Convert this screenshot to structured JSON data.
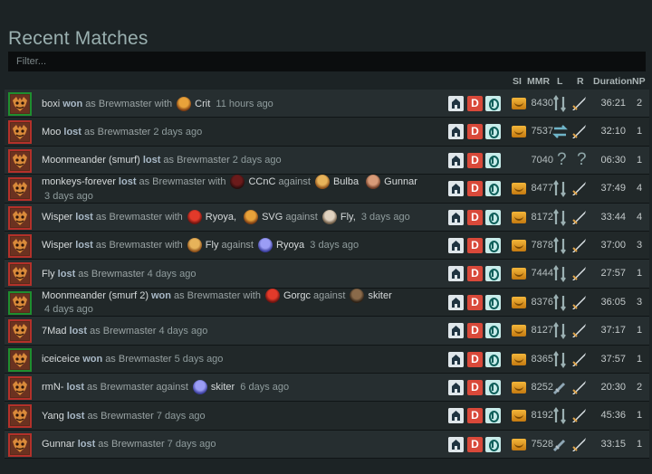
{
  "title": "Recent Matches",
  "filter": {
    "placeholder": "Filter..."
  },
  "headers": {
    "si": "SI",
    "mmr": "MMR",
    "l": "L",
    "r": "R",
    "duration": "Duration",
    "np": "NP"
  },
  "colors": {
    "win_border": "#1f8e2f",
    "loss_border": "#b3312a",
    "dire_red": "#d9493a"
  },
  "matches": [
    {
      "result": "win",
      "player": "boxi",
      "result_text": "won",
      "hero_text": "as Brewmaster",
      "with_text": "with",
      "with": [
        {
          "name": "Crit",
          "pic": "p1"
        }
      ],
      "against_text": "",
      "against": [],
      "ago": "11 hours ago",
      "mode": "D",
      "mmr": "8430",
      "lane_l": "mid-arrows",
      "lane_r": "sword",
      "duration": "36:21",
      "np": "2"
    },
    {
      "result": "loss",
      "player": "Moo",
      "result_text": "lost",
      "hero_text": "as Brewmaster",
      "with_text": "",
      "with": [],
      "against_text": "",
      "against": [],
      "ago": "2 days ago",
      "mode": "D",
      "mmr": "7537",
      "lane_l": "swap",
      "lane_r": "sword",
      "duration": "32:10",
      "np": "1"
    },
    {
      "result": "loss",
      "player": "Moonmeander (smurf)",
      "result_text": "lost",
      "hero_text": "as Brewmaster",
      "with_text": "",
      "with": [],
      "against_text": "",
      "against": [],
      "ago": "2 days ago",
      "mode": "D",
      "mmr": "7040",
      "lane_l": "unknown",
      "lane_r": "unknown",
      "duration": "06:30",
      "np": "1",
      "no_medal": true
    },
    {
      "result": "loss",
      "player": "monkeys-forever",
      "result_text": "lost",
      "hero_text": "as Brewmaster",
      "with_text": "with",
      "with": [
        {
          "name": "CCnC",
          "pic": "p2"
        }
      ],
      "against_text": "against",
      "against": [
        {
          "name": "Bulba",
          "pic": "p3"
        },
        {
          "name": "Gunnar",
          "pic": "p4"
        }
      ],
      "ago": "3 days ago",
      "mode": "D",
      "mmr": "8477",
      "lane_l": "mid-arrows",
      "lane_r": "sword",
      "duration": "37:49",
      "np": "4"
    },
    {
      "result": "loss",
      "player": "Wisper",
      "result_text": "lost",
      "hero_text": "as Brewmaster",
      "with_text": "with",
      "with": [
        {
          "name": "Ryoya,",
          "pic": "p5"
        },
        {
          "name": "SVG",
          "pic": "p1"
        }
      ],
      "against_text": "against",
      "against": [
        {
          "name": "Fly,",
          "pic": "p6"
        }
      ],
      "ago": "3 days ago",
      "mode": "D",
      "mmr": "8172",
      "lane_l": "mid-arrows",
      "lane_r": "sword",
      "duration": "33:44",
      "np": "4"
    },
    {
      "result": "loss",
      "player": "Wisper",
      "result_text": "lost",
      "hero_text": "as Brewmaster",
      "with_text": "with",
      "with": [
        {
          "name": "Fly",
          "pic": "p3"
        }
      ],
      "against_text": "against",
      "against": [
        {
          "name": "Ryoya",
          "pic": "p7"
        }
      ],
      "ago": "3 days ago",
      "mode": "D",
      "mmr": "7878",
      "lane_l": "mid-arrows",
      "lane_r": "sword",
      "duration": "37:00",
      "np": "3"
    },
    {
      "result": "loss",
      "player": "Fly",
      "result_text": "lost",
      "hero_text": "as Brewmaster",
      "with_text": "",
      "with": [],
      "against_text": "",
      "against": [],
      "ago": "4 days ago",
      "mode": "D",
      "mmr": "7444",
      "lane_l": "mid-arrows",
      "lane_r": "sword",
      "duration": "27:57",
      "np": "1"
    },
    {
      "result": "win",
      "player": "Moonmeander (smurf 2)",
      "result_text": "won",
      "hero_text": "as Brewmaster",
      "with_text": "with",
      "with": [
        {
          "name": "Gorgc",
          "pic": "p5"
        }
      ],
      "against_text": "against",
      "against": [
        {
          "name": "skiter",
          "pic": "p8"
        }
      ],
      "ago": "4 days ago",
      "mode": "D",
      "mmr": "8376",
      "lane_l": "mid-arrows",
      "lane_r": "sword",
      "duration": "36:05",
      "np": "3"
    },
    {
      "result": "loss",
      "player": "7Mad",
      "result_text": "lost",
      "hero_text": "as Brewmaster",
      "with_text": "",
      "with": [],
      "against_text": "",
      "against": [],
      "ago": "4 days ago",
      "mode": "D",
      "mmr": "8127",
      "lane_l": "mid-arrows",
      "lane_r": "sword",
      "duration": "37:17",
      "np": "1"
    },
    {
      "result": "win",
      "player": "iceiceice",
      "result_text": "won",
      "hero_text": "as Brewmaster",
      "with_text": "",
      "with": [],
      "against_text": "",
      "against": [],
      "ago": "5 days ago",
      "mode": "D",
      "mmr": "8365",
      "lane_l": "mid-arrows",
      "lane_r": "sword",
      "duration": "37:57",
      "np": "1"
    },
    {
      "result": "loss",
      "player": "rmN-",
      "result_text": "lost",
      "hero_text": "as Brewmaster",
      "with_text": "",
      "with": [],
      "against_text": "against",
      "against": [
        {
          "name": "skiter",
          "pic": "p7"
        }
      ],
      "ago": "6 days ago",
      "mode": "D",
      "mmr": "8252",
      "lane_l": "sword-small",
      "lane_r": "sword",
      "duration": "20:30",
      "np": "2"
    },
    {
      "result": "loss",
      "player": "Yang",
      "result_text": "lost",
      "hero_text": "as Brewmaster",
      "with_text": "",
      "with": [],
      "against_text": "",
      "against": [],
      "ago": "7 days ago",
      "mode": "D",
      "mmr": "8192",
      "lane_l": "mid-arrows",
      "lane_r": "sword",
      "duration": "45:36",
      "np": "1"
    },
    {
      "result": "loss",
      "player": "Gunnar",
      "result_text": "lost",
      "hero_text": "as Brewmaster",
      "with_text": "",
      "with": [],
      "against_text": "",
      "against": [],
      "ago": "7 days ago",
      "mode": "D",
      "mmr": "7528",
      "lane_l": "sword-small",
      "lane_r": "sword",
      "duration": "33:15",
      "np": "1"
    }
  ]
}
